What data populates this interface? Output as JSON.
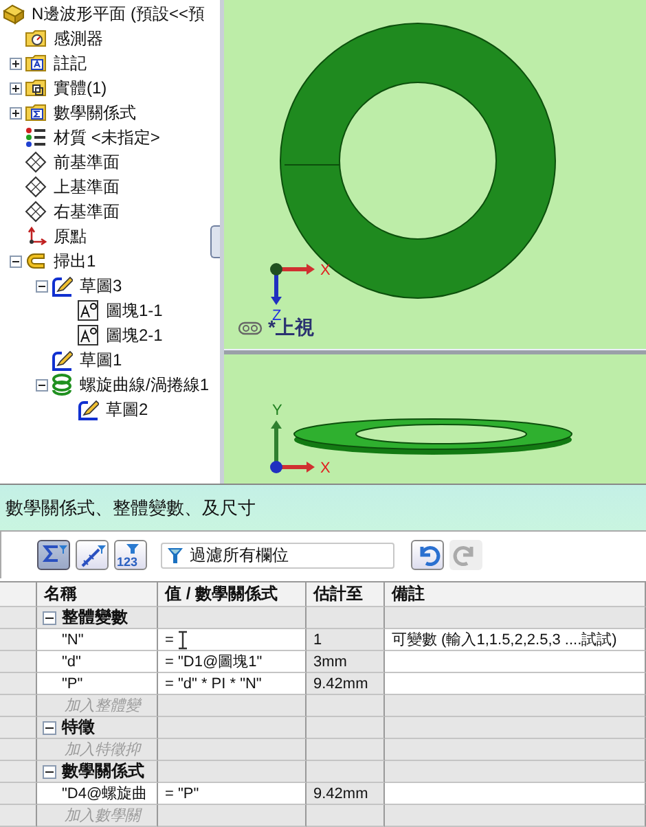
{
  "tree": [
    {
      "label": "N邊波形平面 (預設<<預",
      "kind": "part",
      "children": [
        {
          "label": "感測器",
          "kind": "sensors"
        },
        {
          "label": "註記",
          "kind": "annotations",
          "expanded": false
        },
        {
          "label": "實體(1)",
          "kind": "solids",
          "expanded": false
        },
        {
          "label": "數學關係式",
          "kind": "equations",
          "expanded": false
        },
        {
          "label": "材質 <未指定>",
          "kind": "material"
        },
        {
          "label": "前基準面",
          "kind": "plane"
        },
        {
          "label": "上基準面",
          "kind": "plane"
        },
        {
          "label": "右基準面",
          "kind": "plane"
        },
        {
          "label": "原點",
          "kind": "origin"
        },
        {
          "label": "掃出1",
          "kind": "sweep",
          "expanded": true,
          "children": [
            {
              "label": "草圖3",
              "kind": "sketch",
              "expanded": true,
              "children": [
                {
                  "label": "圖塊1-1",
                  "kind": "block"
                },
                {
                  "label": "圖塊2-1",
                  "kind": "block"
                }
              ]
            },
            {
              "label": "草圖1",
              "kind": "sketch"
            },
            {
              "label": "螺旋曲線/渦捲線1",
              "kind": "helix",
              "expanded": true,
              "children": [
                {
                  "label": "草圖2",
                  "kind": "sketch"
                }
              ]
            }
          ]
        }
      ]
    }
  ],
  "views": [
    {
      "kind": "top",
      "label": "*上視",
      "axes": [
        "X",
        "Z"
      ]
    },
    {
      "kind": "front",
      "axes": [
        "X",
        "Y"
      ]
    }
  ],
  "equations_panel": {
    "title": "數學關係式、整體變數、及尺寸",
    "toolbar": [
      {
        "kind": "equations",
        "selected": true
      },
      {
        "kind": "sketch-equations",
        "selected": false
      },
      {
        "kind": "ordered",
        "label": "123",
        "selected": false
      }
    ],
    "filter": {
      "placeholder": "過濾所有欄位"
    },
    "undo": {
      "disabled": false
    },
    "redo": {
      "disabled": true
    },
    "columns": [
      "名稱",
      "值 / 數學關係式",
      "估計至",
      "備註"
    ],
    "groups": [
      {
        "label": "整體變數",
        "expanded": true,
        "rows": [
          {
            "name": "\"N\"",
            "value": "=",
            "estimate": "1",
            "note": "可變數 (輸入1,1.5,2,2.5,3 ....試試)",
            "editing": true
          },
          {
            "name": "\"d\"",
            "value": "= \"D1@圖塊1\"",
            "estimate": "3mm",
            "editing": false
          },
          {
            "name": "\"P\"",
            "value": "= \"d\" * PI * \"N\"",
            "estimate": "9.42mm",
            "editing": false
          }
        ],
        "add_placeholder": "加入整體變"
      },
      {
        "label": "特徵",
        "expanded": true,
        "add_placeholder": "加入特徵抑"
      },
      {
        "label": "數學關係式",
        "expanded": true,
        "rows": [
          {
            "name": "\"D4@螺旋曲",
            "value": "= \"P\"",
            "estimate": "9.42mm",
            "editing": false
          }
        ],
        "add_placeholder": "加入數學關"
      }
    ]
  }
}
